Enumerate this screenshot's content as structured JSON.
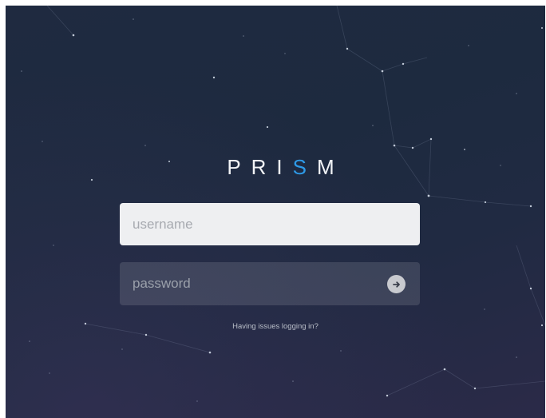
{
  "brand": {
    "letters_plain_1": "PRI",
    "letter_accent": "S",
    "letters_plain_2": "M",
    "accent_color": "#2e9ae8"
  },
  "login_form": {
    "username_placeholder": "username",
    "password_placeholder": "password",
    "submit_icon": "arrow-right-icon"
  },
  "help": {
    "link_text": "Having issues logging in?"
  },
  "colors": {
    "background": "#1e2a3f",
    "username_field": "#eeeff1"
  }
}
